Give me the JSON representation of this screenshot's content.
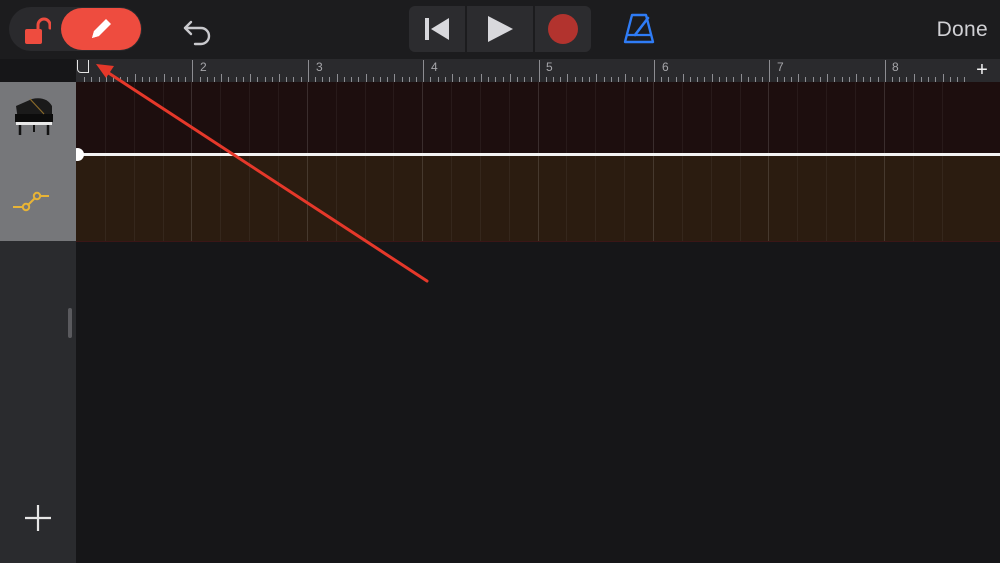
{
  "toolbar": {
    "lock_icon": "unlocked-padlock-icon",
    "pencil_icon": "pencil-icon",
    "undo_icon": "undo-icon",
    "transport": [
      "rewind-to-start-icon",
      "play-icon",
      "record-icon"
    ],
    "metronome_icon": "metronome-icon",
    "done_label": "Done"
  },
  "ruler": {
    "bars": [
      "2",
      "3",
      "4",
      "5",
      "6",
      "7",
      "8"
    ],
    "add_section": "+"
  },
  "track": {
    "instrument_icon": "grand-piano-icon",
    "automation_icon": "automation-curve-icon"
  },
  "sidebar": {
    "add_track_icon": "plus-icon"
  },
  "colors": {
    "accent_red": "#ee4c3f",
    "record_red": "#b2332e",
    "metronome_blue": "#2f7cf6",
    "automation_yellow": "#e8b436"
  }
}
